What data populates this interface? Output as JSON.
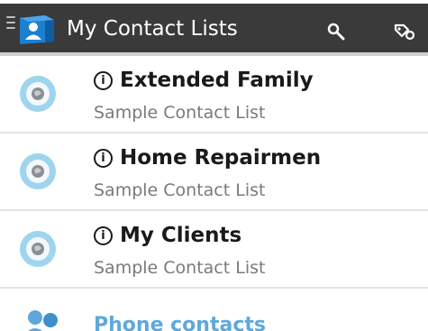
{
  "header": {
    "title": "My Contact Lists",
    "menu_icon": "menu-icon",
    "logo_icon": "contact-book-logo-icon",
    "search_icon": "search-icon",
    "tags_icon": "tags-icon",
    "background_color": "#3a3a3a"
  },
  "contact_lists": [
    {
      "info_symbol": "i",
      "title": "Extended Family",
      "subtitle": "Sample Contact List",
      "icon": "list-globe-icon"
    },
    {
      "info_symbol": "i",
      "title": "Home Repairmen",
      "subtitle": "Sample Contact List",
      "icon": "list-globe-icon"
    },
    {
      "info_symbol": "i",
      "title": "My Clients",
      "subtitle": "Sample Contact List",
      "icon": "list-globe-icon"
    }
  ],
  "phone_contacts": {
    "label": "Phone contacts",
    "icon": "people-icon",
    "color": "#5ea8dc"
  }
}
